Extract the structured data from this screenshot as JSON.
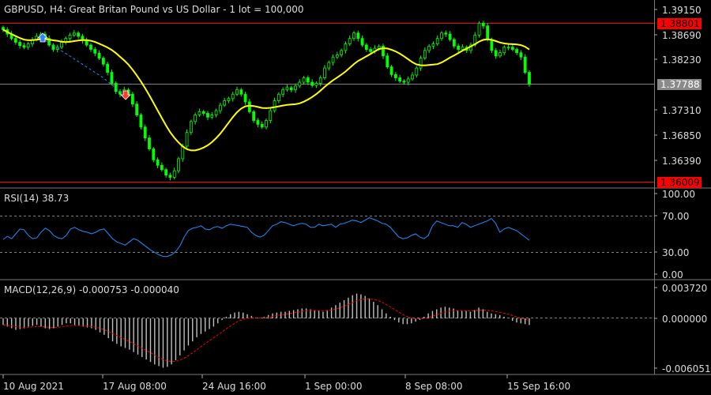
{
  "header": {
    "symbol": "GBPUSD",
    "timeframe": "H4",
    "description": "Great Britan Pound vs US Dollar - 1 lot = 100,000",
    "title_text": "GBPUSD, H4:  Great Britan Pound vs US Dollar - 1 lot = 100,000"
  },
  "colors": {
    "background": "#000000",
    "candle_up": "#00ff00",
    "candle_down": "#00ff00",
    "moving_average": "#ffff00",
    "level_line": "#ff0000",
    "price_line": "#808080",
    "rsi_line": "#1e90ff",
    "macd_histogram": "#c0c0c0",
    "macd_signal": "#ff0000",
    "grid_dashed": "#808080",
    "sell_arrow": "#ff3b30",
    "buy_arrow": "#2f86ff"
  },
  "price_axis": {
    "ticks": [
      "1.39150",
      "1.38690",
      "1.38230",
      "1.37310",
      "1.36850",
      "1.36390"
    ],
    "upper_level_label": "1.38801",
    "current_price_label": "1.37788",
    "lower_level_label": "1.36009"
  },
  "rsi": {
    "label": "RSI(14) 38.73",
    "ticks": [
      "100.00",
      "70.00",
      "30.00",
      "0.00"
    ]
  },
  "macd": {
    "label": "MACD(12,26,9) -0.000753 -0.000040",
    "ticks": [
      "0.003720",
      "0.000000",
      "-0.006051"
    ]
  },
  "time_axis": {
    "labels": [
      "10 Aug 2021",
      "17 Aug 08:00",
      "24 Aug 16:00",
      "1 Sep 00:00",
      "8 Sep 08:00",
      "15 Sep 16:00"
    ]
  },
  "chart_data": {
    "type": "candlestick",
    "upper_level": 1.38801,
    "lower_level": 1.36009,
    "current_price": 1.37788,
    "price_ylim": [
      1.36,
      1.3925
    ],
    "close_series": [
      1.3878,
      1.387,
      1.3862,
      1.3855,
      1.3849,
      1.3846,
      1.3852,
      1.386,
      1.3866,
      1.387,
      1.3862,
      1.385,
      1.3842,
      1.3846,
      1.3855,
      1.3862,
      1.3868,
      1.3872,
      1.3866,
      1.3858,
      1.385,
      1.3842,
      1.3835,
      1.3826,
      1.3815,
      1.38,
      1.378,
      1.3765,
      1.376,
      1.3768,
      1.376,
      1.3742,
      1.3722,
      1.37,
      1.368,
      1.366,
      1.364,
      1.363,
      1.3622,
      1.3612,
      1.3608,
      1.362,
      1.3642,
      1.3665,
      1.369,
      1.371,
      1.3722,
      1.3728,
      1.3725,
      1.3718,
      1.3722,
      1.373,
      1.374,
      1.3748,
      1.3752,
      1.376,
      1.3768,
      1.376,
      1.3746,
      1.3728,
      1.3712,
      1.3705,
      1.37,
      1.3712,
      1.373,
      1.3748,
      1.376,
      1.3768,
      1.3772,
      1.3768,
      1.3775,
      1.3782,
      1.379,
      1.3782,
      1.3776,
      1.378,
      1.379,
      1.3808,
      1.3818,
      1.3828,
      1.3832,
      1.384,
      1.3852,
      1.3862,
      1.3872,
      1.3862,
      1.385,
      1.3842,
      1.3838,
      1.3844,
      1.3848,
      1.383,
      1.381,
      1.3796,
      1.379,
      1.3784,
      1.3782,
      1.3788,
      1.3795,
      1.3808,
      1.3826,
      1.384,
      1.3848,
      1.3852,
      1.3862,
      1.3872,
      1.387,
      1.386,
      1.3848,
      1.3842,
      1.3846,
      1.384,
      1.385,
      1.3868,
      1.389,
      1.3885,
      1.386,
      1.384,
      1.383,
      1.3836,
      1.3846,
      1.3846,
      1.3842,
      1.3836,
      1.3828,
      1.38,
      1.3778
    ],
    "rsi_values": [
      43,
      47,
      44,
      50,
      56,
      55,
      48,
      44,
      45,
      52,
      57,
      54,
      48,
      45,
      44,
      48,
      56,
      58,
      55,
      53,
      52,
      50,
      52,
      55,
      56,
      50,
      44,
      40,
      38,
      36,
      40,
      44,
      42,
      38,
      34,
      30,
      27,
      24,
      22,
      22,
      24,
      28,
      35,
      46,
      54,
      57,
      58,
      60,
      56,
      55,
      58,
      59,
      57,
      60,
      62,
      61,
      60,
      59,
      58,
      52,
      48,
      46,
      48,
      54,
      60,
      62,
      65,
      64,
      62,
      60,
      62,
      63,
      62,
      58,
      58,
      62,
      60,
      61,
      62,
      58,
      62,
      63,
      65,
      67,
      66,
      64,
      67,
      70,
      68,
      66,
      63,
      62,
      58,
      52,
      46,
      44,
      45,
      48,
      50,
      46,
      44,
      48,
      60,
      66,
      64,
      62,
      60,
      60,
      58,
      64,
      62,
      58,
      60,
      62,
      64,
      66,
      69,
      63,
      52,
      56,
      58,
      56,
      54,
      50,
      46,
      42
    ],
    "macd_hist": [
      -0.0008,
      -0.001,
      -0.0012,
      -0.0014,
      -0.0013,
      -0.0012,
      -0.001,
      -0.0009,
      -0.0008,
      -0.001,
      -0.0012,
      -0.0013,
      -0.0012,
      -0.001,
      -0.0008,
      -0.0006,
      -0.0006,
      -0.0008,
      -0.0009,
      -0.001,
      -0.0011,
      -0.0012,
      -0.0014,
      -0.0017,
      -0.002,
      -0.0024,
      -0.0028,
      -0.0031,
      -0.0034,
      -0.0036,
      -0.0038,
      -0.0041,
      -0.0044,
      -0.0047,
      -0.005,
      -0.0053,
      -0.0056,
      -0.0058,
      -0.006,
      -0.0059,
      -0.0056,
      -0.0051,
      -0.0045,
      -0.0039,
      -0.0033,
      -0.0028,
      -0.0023,
      -0.0019,
      -0.0016,
      -0.0013,
      -0.001,
      -0.0006,
      -0.0002,
      0.0002,
      0.0005,
      0.0007,
      0.0008,
      0.0007,
      0.0005,
      0.0003,
      0.0001,
      0.0,
      0.0002,
      0.0004,
      0.0006,
      0.0007,
      0.0008,
      0.0008,
      0.0009,
      0.001,
      0.0011,
      0.0012,
      0.0012,
      0.0011,
      0.001,
      0.0009,
      0.0008,
      0.001,
      0.0013,
      0.0016,
      0.0019,
      0.0022,
      0.0025,
      0.0028,
      0.003,
      0.0029,
      0.0027,
      0.0024,
      0.002,
      0.0016,
      0.0011,
      0.0006,
      0.0002,
      -0.0002,
      -0.0005,
      -0.0007,
      -0.0007,
      -0.0006,
      -0.0004,
      -0.0002,
      0.0002,
      0.0006,
      0.0009,
      0.0011,
      0.0013,
      0.0014,
      0.0013,
      0.0012,
      0.001,
      0.0009,
      0.0009,
      0.0008,
      0.001,
      0.0013,
      0.0011,
      0.0008,
      0.0006,
      0.0005,
      0.0004,
      0.0002,
      0.0,
      -0.0003,
      -0.0005,
      -0.0006,
      -0.0007,
      -0.0008
    ],
    "macd_ylim": [
      -0.006051,
      0.00372
    ]
  }
}
